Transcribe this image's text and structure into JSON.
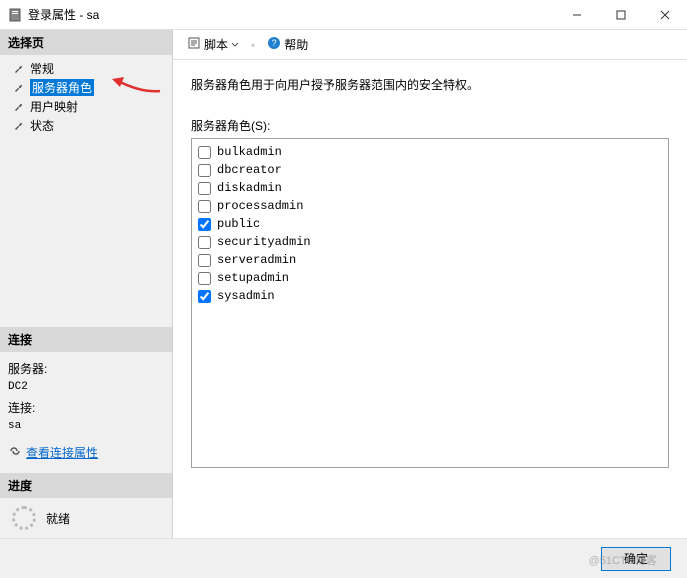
{
  "window": {
    "title": "登录属性 - sa",
    "minimize": "—",
    "maximize": "☐",
    "close": "✕"
  },
  "left": {
    "pages_header": "选择页",
    "nav": {
      "general": "常规",
      "server_roles": "服务器角色",
      "user_mapping": "用户映射",
      "status": "状态"
    },
    "conn_header": "连接",
    "conn": {
      "server_label": "服务器:",
      "server_value": "DC2",
      "connection_label": "连接:",
      "connection_value": "sa",
      "view_link": "查看连接属性"
    },
    "progress_header": "进度",
    "progress_status": "就绪"
  },
  "toolbar": {
    "script": "脚本",
    "help": "帮助"
  },
  "content": {
    "description": "服务器角色用于向用户授予服务器范围内的安全特权。",
    "roles_label": "服务器角色(S):",
    "roles": [
      {
        "name": "bulkadmin",
        "checked": false
      },
      {
        "name": "dbcreator",
        "checked": false
      },
      {
        "name": "diskadmin",
        "checked": false
      },
      {
        "name": "processadmin",
        "checked": false
      },
      {
        "name": "public",
        "checked": true
      },
      {
        "name": "securityadmin",
        "checked": false
      },
      {
        "name": "serveradmin",
        "checked": false
      },
      {
        "name": "setupadmin",
        "checked": false
      },
      {
        "name": "sysadmin",
        "checked": true
      }
    ]
  },
  "footer": {
    "ok": "确定",
    "watermark": "@51CTO博客"
  }
}
